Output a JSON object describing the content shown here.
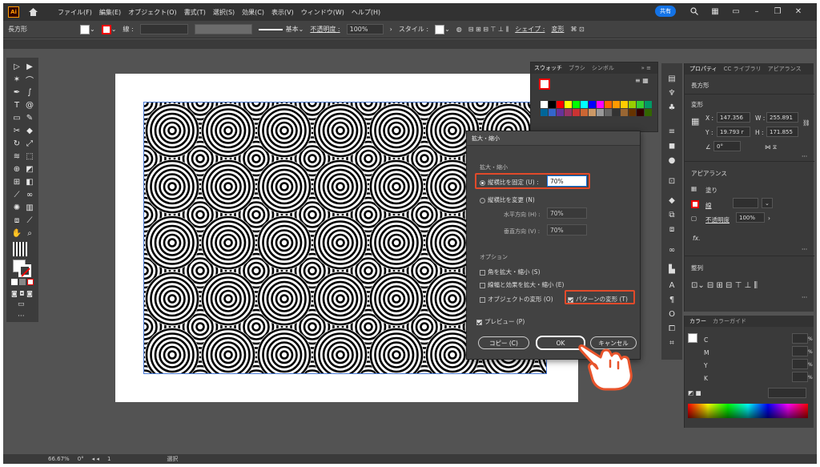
{
  "app": {
    "logo": "Ai",
    "menu": [
      "ファイル(F)",
      "編集(E)",
      "オブジェクト(O)",
      "書式(T)",
      "選択(S)",
      "効果(C)",
      "表示(V)",
      "ウィンドウ(W)",
      "ヘルプ(H)"
    ],
    "share_label": "共有"
  },
  "control_bar": {
    "object_type": "長方形",
    "stroke_label": "線 :",
    "stroke_style": "基本",
    "opacity_label": "不透明度 :",
    "opacity_value": "100%",
    "style_label": "スタイル :",
    "shape_label": "シェイプ :",
    "transform_label": "変形"
  },
  "swatches_panel": {
    "tabs": [
      "スウォッチ",
      "ブラシ",
      "シンボル"
    ],
    "colors": [
      "#ffffff",
      "#000000",
      "#ff0000",
      "#ffff00",
      "#00ff00",
      "#00ffff",
      "#0000ff",
      "#ff00ff",
      "#ff6600",
      "#ff9900",
      "#ffcc00",
      "#99cc00",
      "#33cc33",
      "#009966",
      "#006699",
      "#3366cc",
      "#663399",
      "#993366",
      "#cc3333",
      "#cc6633",
      "#cc9966",
      "#999999",
      "#666666",
      "#333333",
      "#996633",
      "#663300",
      "#330000",
      "#336600"
    ]
  },
  "dialog": {
    "title": "拡大・縮小",
    "section_scale": "拡大・縮小",
    "uniform_label": "縦横比を固定 (U) :",
    "uniform_value": "70%",
    "non_uniform_label": "縦横比を変更 (N)",
    "horizontal_label": "水平方向 (H) :",
    "horizontal_value": "70%",
    "vertical_label": "垂直方向 (V) :",
    "vertical_value": "70%",
    "options_label": "オプション",
    "opt_corners": "角を拡大・縮小 (S)",
    "opt_strokes": "線幅と効果を拡大・縮小 (E)",
    "opt_objects": "オブジェクトの変形 (O)",
    "opt_patterns": "パターンの変形 (T)",
    "preview_label": "プレビュー (P)",
    "copy_button": "コピー (C)",
    "ok_button": "OK",
    "cancel_button": "キャンセル"
  },
  "properties": {
    "tabs": [
      "プロパティ",
      "CC ライブラリ",
      "アピアランス"
    ],
    "object_type": "長方形",
    "transform_title": "変形",
    "x_label": "X :",
    "x_value": "147.356",
    "y_label": "Y :",
    "y_value": "19.793 r",
    "w_label": "W :",
    "w_value": "255.891",
    "h_label": "H :",
    "h_value": "171.855",
    "angle_value": "0°",
    "appearance_title": "アピアランス",
    "fill_label": "塗り",
    "stroke_label": "線",
    "opacity_label": "不透明度",
    "opacity_value": "100%",
    "fx_label": "fx.",
    "align_title": "整列"
  },
  "color_panel": {
    "tabs": [
      "カラー",
      "カラーガイド"
    ],
    "channels": [
      "C",
      "M",
      "Y",
      "K"
    ],
    "unit": "%"
  },
  "status_bar": {
    "zoom": "66.67%",
    "angle": "0°",
    "artboard": "1",
    "mode": "選択"
  }
}
